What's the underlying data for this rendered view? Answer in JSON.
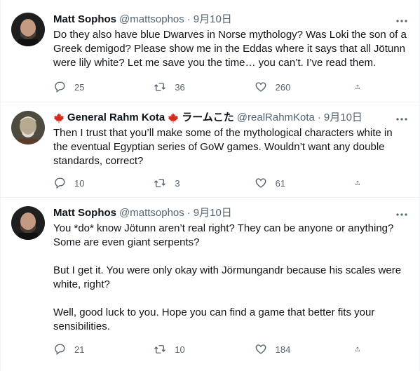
{
  "tweets": [
    {
      "name": "Matt Sophos",
      "handle": "@mattsophos",
      "date": "9月10日",
      "text": "Do they also have blue Dwarves in Norse mythology? Was Loki the son of a Greek demigod? Please show me in the Eddas where it says that all Jötunn were lily white? Let me save you the time… you can’t. I’ve read them.",
      "replies": "25",
      "retweets": "36",
      "likes": "260"
    },
    {
      "name": "General Rahm Kota",
      "name_suffix": "ラームこた",
      "handle": "@realRahmKota",
      "date": "9月10日",
      "text": "Then I trust that you’ll make some of the mythological characters white in the eventual Egyptian series of GoW games. Wouldn’t want any double standards, correct?",
      "replies": "10",
      "retweets": "3",
      "likes": "61"
    },
    {
      "name": "Matt Sophos",
      "handle": "@mattsophos",
      "date": "9月10日",
      "text": "You *do* know Jötunn aren’t real right? They can be anyone or anything? Some are even giant serpents?\n\nBut I get it. You were only okay with Jörmungandr because his scales were white, right?\n\nWell, good luck to you. Hope you can find a game that better fits your sensibilities.",
      "replies": "21",
      "retweets": "10",
      "likes": "184"
    }
  ],
  "icons": {
    "reply": "reply-icon",
    "retweet": "retweet-icon",
    "like": "heart-icon",
    "share": "share-icon",
    "more": "more-icon",
    "flag": "maple-leaf-icon"
  },
  "colors": {
    "text": "#0f1419",
    "secondary": "#536471",
    "divider": "#eff3f4",
    "flag_red": "#d52b1e"
  }
}
